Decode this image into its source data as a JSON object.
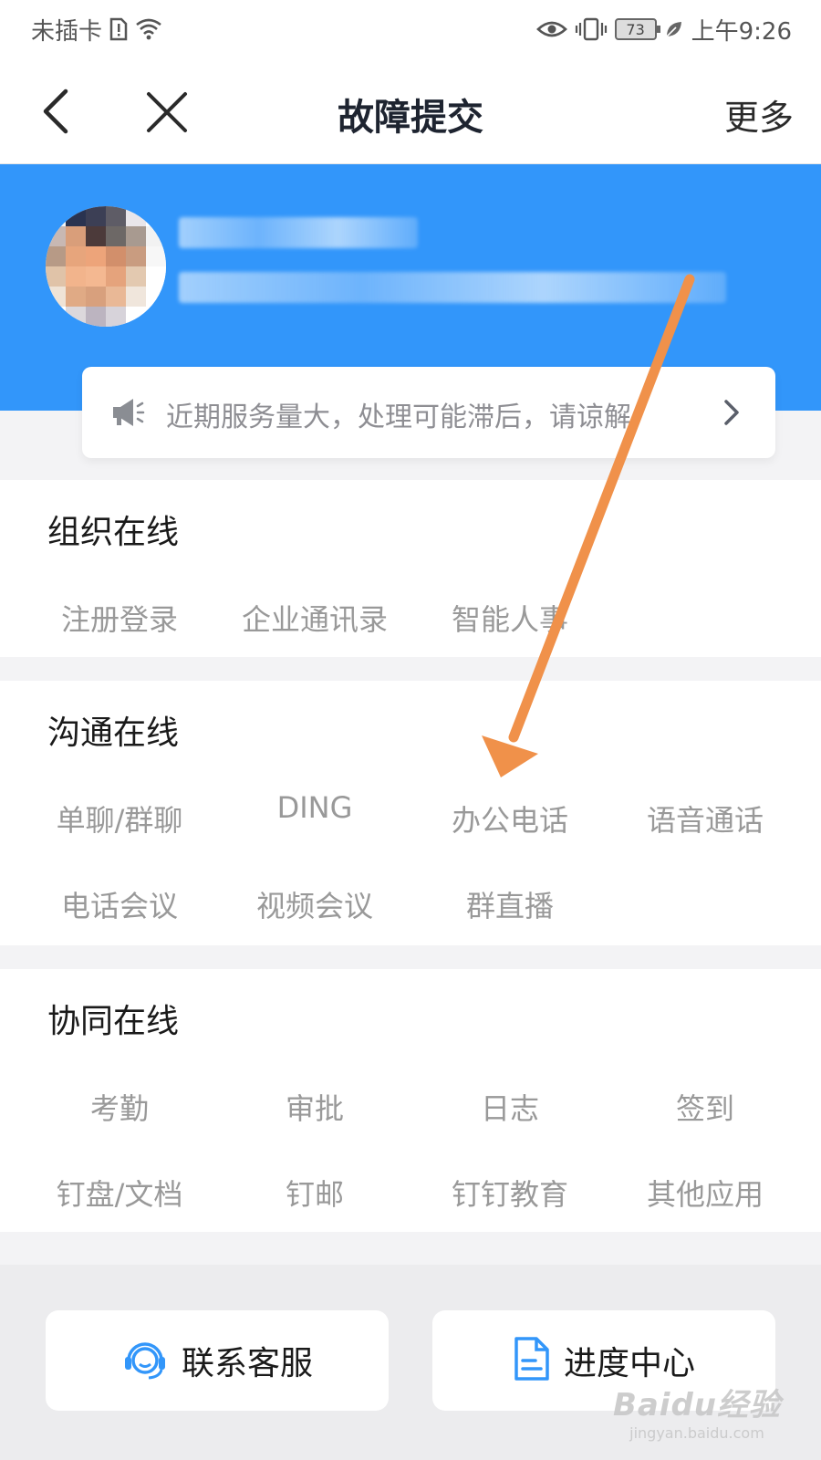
{
  "status_bar": {
    "carrier": "未插卡",
    "battery": "73",
    "time": "上午9:26"
  },
  "nav": {
    "title": "故障提交",
    "more": "更多"
  },
  "notice": {
    "text": "近期服务量大，处理可能滞后，请谅解"
  },
  "sections": {
    "org": {
      "title": "组织在线",
      "items": [
        "注册登录",
        "企业通讯录",
        "智能人事"
      ]
    },
    "comm": {
      "title": "沟通在线",
      "items": [
        "单聊/群聊",
        "DING",
        "办公电话",
        "语音通话",
        "电话会议",
        "视频会议",
        "群直播"
      ]
    },
    "collab": {
      "title": "协同在线",
      "items": [
        "考勤",
        "审批",
        "日志",
        "签到",
        "钉盘/文档",
        "钉邮",
        "钉钉教育",
        "其他应用"
      ]
    }
  },
  "bottom": {
    "contact_label": "联系客服",
    "progress_label": "进度中心"
  },
  "watermark": {
    "logo": "Baidu经验",
    "url": "jingyan.baidu.com"
  },
  "colors": {
    "brand_blue": "#3296fa",
    "annotation_orange": "#f0914a",
    "muted_text": "#999999"
  }
}
